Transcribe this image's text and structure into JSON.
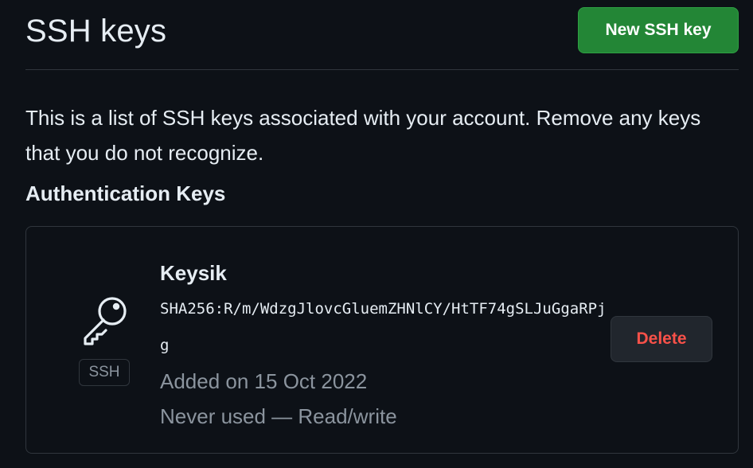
{
  "header": {
    "title": "SSH keys",
    "new_key_label": "New SSH key"
  },
  "intro": {
    "description": "This is a list of SSH keys associated with your account. Remove any keys that you do not recognize."
  },
  "section": {
    "heading": "Authentication Keys"
  },
  "keys": [
    {
      "icon": "key-icon",
      "badge": "SSH",
      "title": "Keysik",
      "fingerprint": "SHA256:R/m/WdzgJlovcGluemZHNlCY/HtTF74gSLJuGgaRPjg",
      "added": "Added on 15 Oct 2022",
      "usage": "Never used — Read/write",
      "delete_label": "Delete"
    }
  ],
  "colors": {
    "background": "#0d1117",
    "border": "#30363d",
    "primary_button": "#238636",
    "danger_text": "#f85149",
    "muted_text": "#8b949e"
  }
}
